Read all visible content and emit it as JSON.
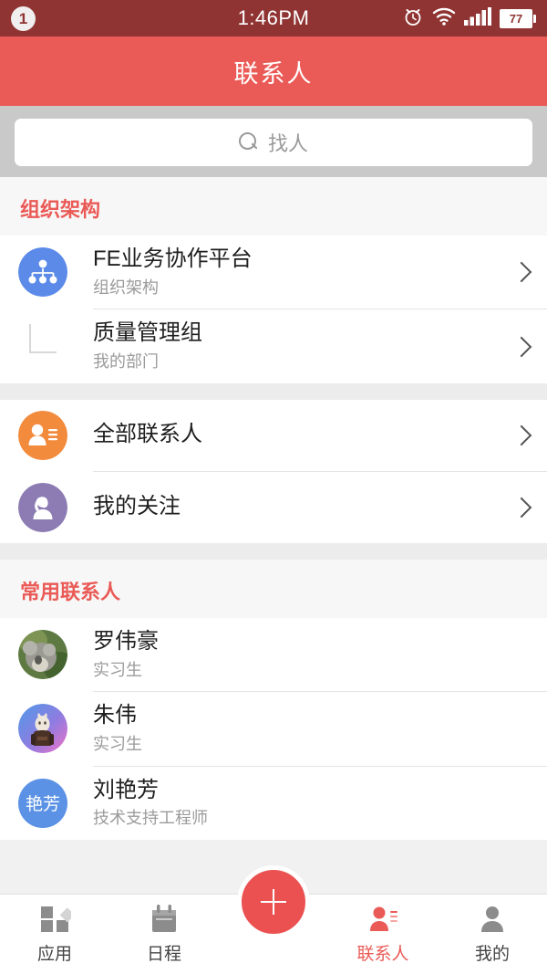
{
  "statusbar": {
    "notification_count": "1",
    "time": "1:46PM",
    "battery_level": "77",
    "icons": [
      "alarm-icon",
      "wifi-icon",
      "signal-icon",
      "battery-icon"
    ]
  },
  "header": {
    "title": "联系人",
    "background": "#ea5a56"
  },
  "search": {
    "placeholder": "找人",
    "icon": "search-icon"
  },
  "sections": [
    {
      "title": "组织架构"
    },
    {
      "title": "常用联系人"
    }
  ],
  "org_rows": [
    {
      "title": "FE业务协作平台",
      "subtitle": "组织架构",
      "icon": "org-chart-icon",
      "icon_color": "#5b8ae8",
      "chevron": "chevron-right-icon"
    },
    {
      "title": "质量管理组",
      "subtitle": "我的部门",
      "icon": "tree-branch-icon",
      "icon_color": "#d8d8d8",
      "chevron": "chevron-right-icon"
    }
  ],
  "list_rows": [
    {
      "title": "全部联系人",
      "icon": "contacts-list-icon",
      "icon_color": "#f28b3c",
      "chevron": "chevron-right-icon"
    },
    {
      "title": "我的关注",
      "icon": "person-female-icon",
      "icon_color": "#8c7cb3",
      "chevron": "chevron-right-icon"
    }
  ],
  "contacts": [
    {
      "name": "罗伟豪",
      "role": "实习生",
      "avatar_type": "photo-koala",
      "avatar_color": "#8a9a7b"
    },
    {
      "name": "朱伟",
      "role": "实习生",
      "avatar_type": "photo-rabbit",
      "avatar_color": "#6fa8e8"
    },
    {
      "name": "刘艳芳",
      "role": "技术支持工程师",
      "avatar_type": "initials",
      "avatar_initials": "艳芳",
      "avatar_color": "#5b92e5"
    }
  ],
  "fab": {
    "label": "+",
    "color": "#ea5150",
    "name": "add-button"
  },
  "tabs": [
    {
      "label": "应用",
      "icon": "apps-grid-icon",
      "active": false
    },
    {
      "label": "日程",
      "icon": "calendar-icon",
      "active": false
    },
    {
      "label": "联系人",
      "icon": "contacts-icon",
      "active": true
    },
    {
      "label": "我的",
      "icon": "profile-icon",
      "active": false
    }
  ],
  "colors": {
    "accent": "#ea5a56",
    "statusbar": "#8f3433",
    "muted_text": "#9b9b9b"
  }
}
